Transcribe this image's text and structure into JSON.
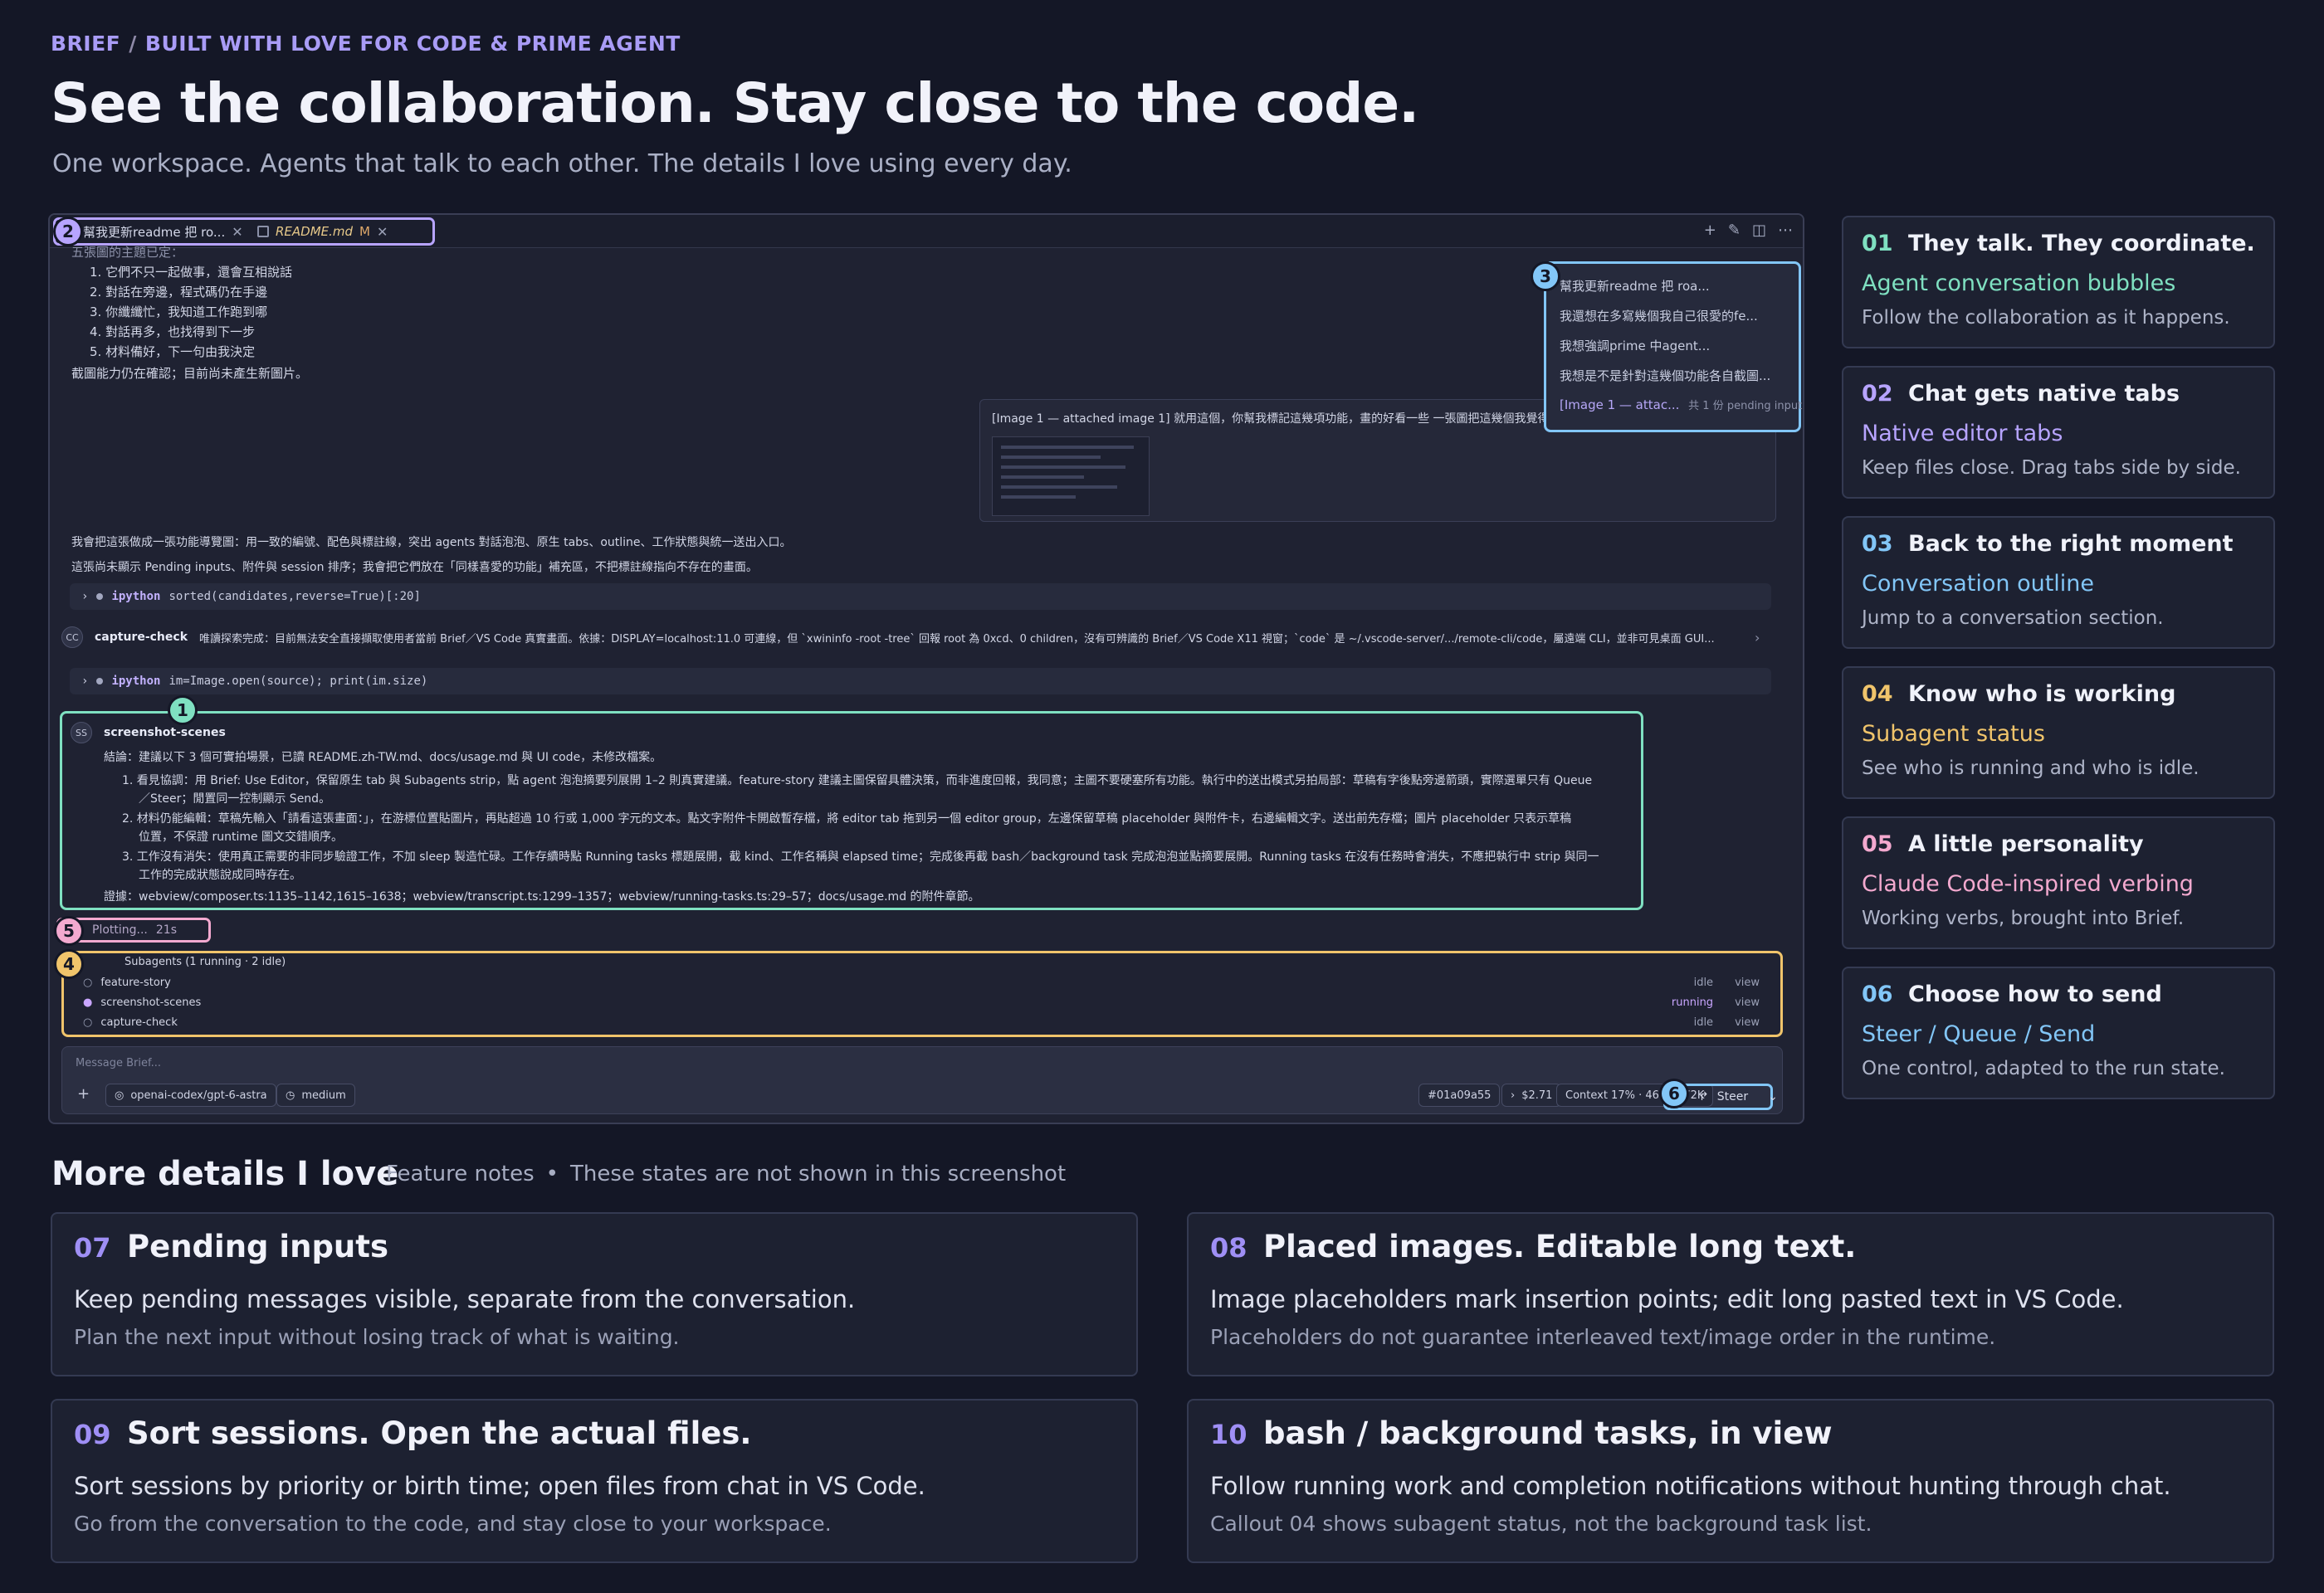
{
  "header": {
    "crumb_primary": "BRIEF",
    "crumb_sep": "/",
    "crumb_secondary": "BUILT WITH LOVE FOR CODE & PRIME AGENT",
    "title": "See the collaboration. Stay close to the code.",
    "subtitle": "One workspace. Agents that talk to each other. The details I love using every day."
  },
  "screenshot": {
    "tabs": [
      {
        "label": "幫我更新readme 把 ro...",
        "close": "✕"
      },
      {
        "label": "README.md",
        "modified": "M",
        "close": "✕"
      }
    ],
    "chat_top_fragment": "五張圖的主題已定：",
    "numbered_lines": [
      "1. 它們不只一起做事，還會互相說話",
      "2. 對話在旁邊，程式碼仍在手邊",
      "3. 你纖纖忙，我知道工作跑到哪",
      "4. 對話再多，也找得到下一步",
      "5. 材料備好，下一句由我決定"
    ],
    "screenshot_status_line": "截圖能力仍在確認；目前尚未產生新圖片。",
    "image_bubble_text": "[Image 1 — attached image 1] 就用這個，你幫我標記這幾項功能，畫的好看一些 一張圖把這幾個我覺得很喜愛的功能都標記出來",
    "plan_line_1": "我會把這張做成一張功能導覽圖：用一致的編號、配色與標註線，突出 agents 對話泡泡、原生 tabs、outline、工作狀態與統一送出入口。",
    "plan_line_2": "這張尚未顯示 Pending inputs、附件與 session 排序；我會把它們放在「同樣喜愛的功能」補充區，不把標註線指向不存在的畫面。",
    "tool_call_1": {
      "tool": "ipython",
      "code": "sorted(candidates,reverse=True)[:20]"
    },
    "capture_check": {
      "avatar": "CC",
      "name": "capture-check",
      "text": "唯讀探索完成：目前無法安全直接擷取使用者當前 Brief／VS Code 真實畫面。依據：DISPLAY=localhost:11.0 可連線，但 `xwininfo -root -tree` 回報 root 為 0xcd、0 children，沒有可辨識的 Brief／VS Code X11 視窗；`code` 是 ~/.vscode-server/.../remote-cli/code，屬遠端 CLI，並非可見桌面 GUI...",
      "chevron": "›"
    },
    "tool_call_2": {
      "tool": "ipython",
      "code": "im=Image.open(source); print(im.size)"
    },
    "scenes": {
      "avatar": "SS",
      "name": "screenshot-scenes",
      "summary": "結論：建議以下 3 個可實拍場景，已讀 README.zh-TW.md、docs/usage.md 與 UI code，未修改檔案。",
      "items": [
        "1. 看見協調：用 Brief: Use Editor，保留原生 tab 與 Subagents strip，點 agent 泡泡摘要列展開 1–2 則真實建議。feature-story 建議主圖保留具體決策，而非進度回報，我同意；主圖不要硬塞所有功能。執行中的送出模式另拍局部：草稿有字後點旁邊箭頭，實際選單只有 Queue",
        "／Steer；閒置同一控制顯示 Send。",
        "2. 材料仍能編輯：草稿先輸入「請看這張畫面：」，在游標位置貼圖片，再貼超過 10 行或 1,000 字元的文本。點文字附件卡開啟暫存檔，將 editor tab 拖到另一個 editor group，左邊保留草稿 placeholder 與附件卡，右邊編輯文字。送出前先存檔；圖片 placeholder 只表示草稿",
        "位置，不保證 runtime 圖文交錯順序。",
        "3. 工作沒有消失：使用真正需要的非同步驗證工作，不加 sleep 製造忙碌。工作存續時點 Running tasks 標題展開，截 kind、工作名稱與 elapsed time；完成後再截 bash／background task 完成泡泡並點摘要展開。Running tasks 在沒有任務時會消失，不應把執行中 strip 與同一",
        "工作的完成狀態說成同時存在。"
      ],
      "evidence": "證據：webview/composer.ts:1135–1142,1615–1638；webview/transcript.ts:1299–1357；webview/running-tasks.ts:29–57；docs/usage.md 的附件章節。"
    },
    "outline": [
      "幫我更新readme 把 roa...",
      "我還想在多寫幾個我自己很愛的fe...",
      "我想強調prime 中agent...",
      "我想是不是針對這幾個功能各自截圖...",
      "[Image 1 — attac..."
    ],
    "outline_trailing": "共 1 份 pending inputs",
    "status_verb": {
      "text": "Plotting...",
      "elapsed": "21s"
    },
    "subagents": {
      "header": "Subagents (1 running · 2 idle)",
      "rows": [
        {
          "name": "feature-story",
          "status": "idle",
          "action": "view"
        },
        {
          "name": "screenshot-scenes",
          "status": "running",
          "action": "view"
        },
        {
          "name": "capture-check",
          "status": "idle",
          "action": "view"
        }
      ]
    },
    "composer": {
      "placeholder": "Message Brief...",
      "add": "+",
      "model": "openai-codex/gpt-6-astra",
      "effort": "medium",
      "commit": "#01a09a55",
      "cost": "$2.71",
      "context": "Context 17% · 46K / 272K",
      "send_label": "Steer",
      "send_chevron": "⌄"
    },
    "callouts": [
      {
        "n": "1",
        "color": "#7fe0c1"
      },
      {
        "n": "2",
        "color": "#b7a4ff"
      },
      {
        "n": "3",
        "color": "#82c6f7"
      },
      {
        "n": "4",
        "color": "#f0c46b"
      },
      {
        "n": "5",
        "color": "#f3a9cf"
      },
      {
        "n": "6",
        "color": "#82c6f7"
      }
    ]
  },
  "features": [
    {
      "num": "01",
      "title": "They talk. They coordinate.",
      "sub": "Agent conversation bubbles",
      "desc": "Follow the collaboration as it happens.",
      "accent": "#7fe0c1"
    },
    {
      "num": "02",
      "title": "Chat gets native tabs",
      "sub": "Native editor tabs",
      "desc": "Keep files close. Drag tabs side by side.",
      "accent": "#b7a4ff"
    },
    {
      "num": "03",
      "title": "Back to the right moment",
      "sub": "Conversation outline",
      "desc": "Jump to a conversation section.",
      "accent": "#82c6f7"
    },
    {
      "num": "04",
      "title": "Know who is working",
      "sub": "Subagent status",
      "desc": "See who is running and who is idle.",
      "accent": "#f0c46b"
    },
    {
      "num": "05",
      "title": "A little personality",
      "sub": "Claude Code-inspired verbing",
      "desc": "Working verbs, brought into Brief.",
      "accent": "#f3a9cf"
    },
    {
      "num": "06",
      "title": "Choose how to send",
      "sub": "Steer / Queue / Send",
      "desc": "One control, adapted to the run state.",
      "accent": "#82c6f7"
    }
  ],
  "more": {
    "title": "More details I love",
    "note_a": "Feature notes",
    "note_bullet": "•",
    "note_b": "These states are not shown in this screenshot",
    "cards": [
      {
        "num": "07",
        "title": "Pending inputs",
        "line1": "Keep pending messages visible, separate from the conversation.",
        "line2": "Plan the next input without losing track of what is waiting."
      },
      {
        "num": "08",
        "title": "Placed images. Editable long text.",
        "line1": "Image placeholders mark insertion points; edit long pasted text in VS Code.",
        "line2": "Placeholders do not guarantee interleaved text/image order in the runtime."
      },
      {
        "num": "09",
        "title": "Sort sessions. Open the actual files.",
        "line1": "Sort sessions by priority or birth time; open files from chat in VS Code.",
        "line2": "Go from the conversation to the code, and stay close to your workspace."
      },
      {
        "num": "10",
        "title": "bash / background tasks, in view",
        "line1": "Follow running work and completion notifications without hunting through chat.",
        "line2": "Callout 04 shows subagent status, not the background task list."
      }
    ]
  }
}
